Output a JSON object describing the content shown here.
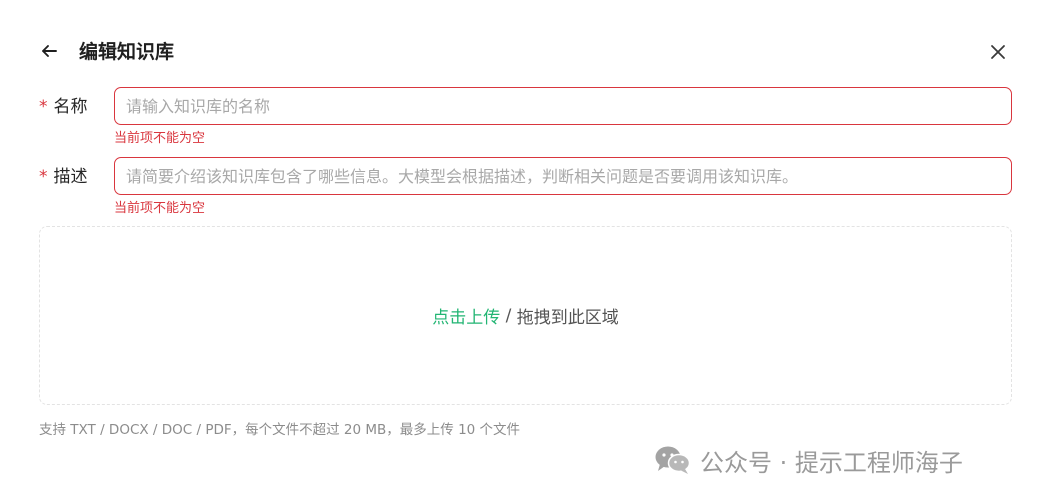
{
  "header": {
    "title": "编辑知识库"
  },
  "form": {
    "name": {
      "required_mark": "*",
      "label": "名称",
      "placeholder": "请输入知识库的名称",
      "value": "",
      "error": "当前项不能为空"
    },
    "description": {
      "required_mark": "*",
      "label": "描述",
      "placeholder": "请简要介绍该知识库包含了哪些信息。大模型会根据描述，判断相关问题是否要调用该知识库。",
      "value": "",
      "error": "当前项不能为空"
    }
  },
  "upload": {
    "link_text": "点击上传",
    "separator": " / ",
    "drag_text": "拖拽到此区域",
    "hint": "支持 TXT / DOCX / DOC / PDF，每个文件不超过 20 MB，最多上传 10 个文件"
  },
  "watermark": {
    "text": "公众号 · 提示工程师海子"
  },
  "colors": {
    "error": "#d9363e",
    "accent": "#22b573",
    "hint": "#8c8c8c",
    "watermark": "#9a9a9a"
  },
  "icons": {
    "back": "arrow-left-icon",
    "close": "close-icon",
    "watermark": "wechat-icon"
  }
}
